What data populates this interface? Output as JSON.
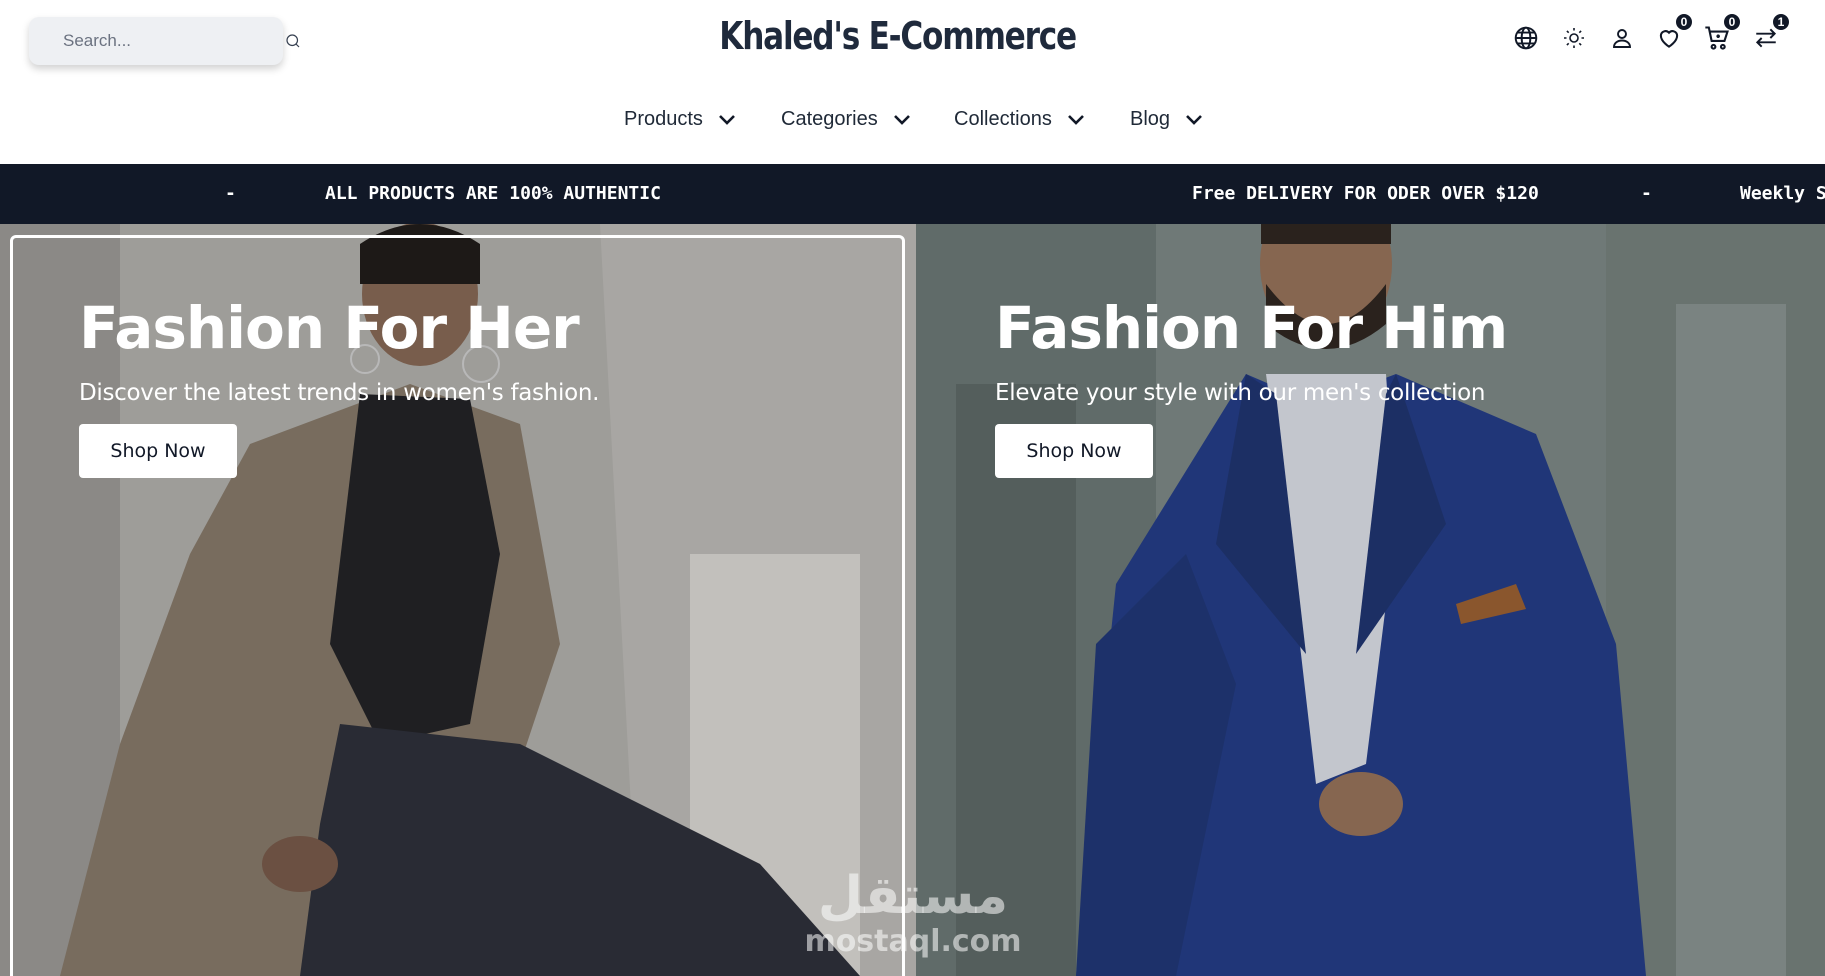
{
  "header": {
    "search_placeholder": "Search...",
    "brand": "Khaled's E-Commerce",
    "icons": {
      "language": "globe-icon",
      "theme": "sun-icon",
      "account": "user-icon",
      "wishlist": "heart-icon",
      "cart": "cart-icon",
      "compare": "arrows-swap-icon"
    },
    "badges": {
      "wishlist": "0",
      "cart": "0",
      "compare": "1"
    }
  },
  "nav": {
    "items": [
      {
        "label": "Products"
      },
      {
        "label": "Categories"
      },
      {
        "label": "Collections"
      },
      {
        "label": "Blog"
      }
    ]
  },
  "marquee": {
    "items": [
      "-",
      "ALL PRODUCTS ARE 100% AUTHENTIC",
      "Free DELIVERY FOR ODER OVER $120",
      "-",
      "Weekly S"
    ]
  },
  "hero": {
    "her": {
      "title": "Fashion For Her",
      "subtitle": "Discover the latest trends in women's fashion.",
      "button": "Shop Now"
    },
    "him": {
      "title": "Fashion For Him",
      "subtitle": "Elevate your style with our men's collection",
      "button": "Shop Now"
    }
  },
  "watermark": {
    "arabic": "مستقل",
    "latin": "mostaql.com"
  },
  "colors": {
    "marquee_bg": "#111827",
    "brand_text": "#1f2a3c",
    "badge_bg": "#111827",
    "suit_blue": "#1f3a8a"
  }
}
